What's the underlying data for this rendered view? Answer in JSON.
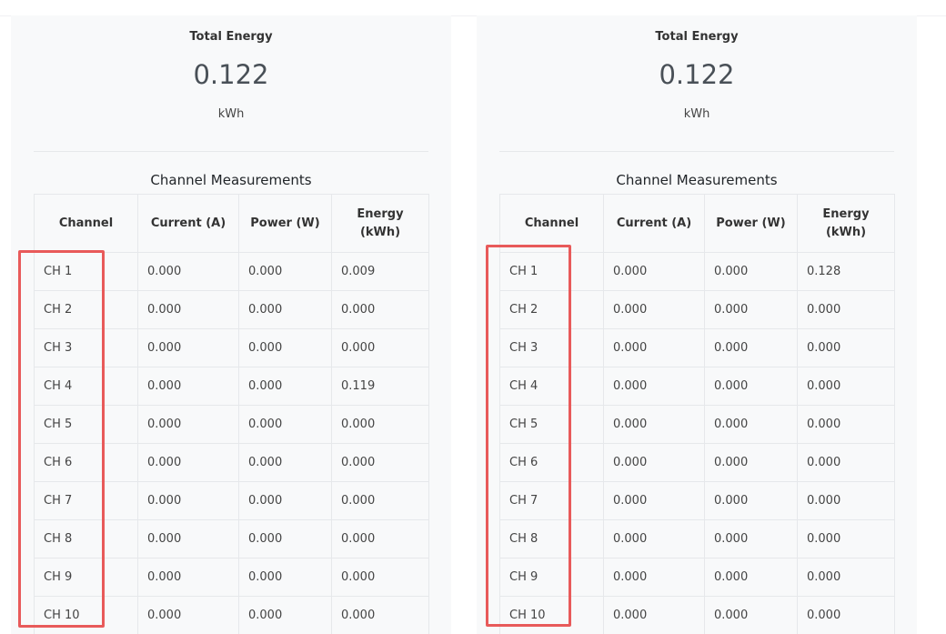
{
  "panels": [
    {
      "summary": {
        "title": "Total Energy",
        "value": "0.122",
        "unit": "kWh"
      },
      "table_title": "Channel Measurements",
      "headers": [
        "Channel",
        "Current (A)",
        "Power (W)",
        "Energy (kWh)"
      ],
      "rows": [
        [
          "CH 1",
          "0.000",
          "0.000",
          "0.009"
        ],
        [
          "CH 2",
          "0.000",
          "0.000",
          "0.000"
        ],
        [
          "CH 3",
          "0.000",
          "0.000",
          "0.000"
        ],
        [
          "CH 4",
          "0.000",
          "0.000",
          "0.119"
        ],
        [
          "CH 5",
          "0.000",
          "0.000",
          "0.000"
        ],
        [
          "CH 6",
          "0.000",
          "0.000",
          "0.000"
        ],
        [
          "CH 7",
          "0.000",
          "0.000",
          "0.000"
        ],
        [
          "CH 8",
          "0.000",
          "0.000",
          "0.000"
        ],
        [
          "CH 9",
          "0.000",
          "0.000",
          "0.000"
        ],
        [
          "CH 10",
          "0.000",
          "0.000",
          "0.000"
        ]
      ]
    },
    {
      "summary": {
        "title": "Total Energy",
        "value": "0.122",
        "unit": "kWh"
      },
      "table_title": "Channel Measurements",
      "headers": [
        "Channel",
        "Current (A)",
        "Power (W)",
        "Energy (kWh)"
      ],
      "rows": [
        [
          "CH 1",
          "0.000",
          "0.000",
          "0.128"
        ],
        [
          "CH 2",
          "0.000",
          "0.000",
          "0.000"
        ],
        [
          "CH 3",
          "0.000",
          "0.000",
          "0.000"
        ],
        [
          "CH 4",
          "0.000",
          "0.000",
          "0.000"
        ],
        [
          "CH 5",
          "0.000",
          "0.000",
          "0.000"
        ],
        [
          "CH 6",
          "0.000",
          "0.000",
          "0.000"
        ],
        [
          "CH 7",
          "0.000",
          "0.000",
          "0.000"
        ],
        [
          "CH 8",
          "0.000",
          "0.000",
          "0.000"
        ],
        [
          "CH 9",
          "0.000",
          "0.000",
          "0.000"
        ],
        [
          "CH 10",
          "0.000",
          "0.000",
          "0.000"
        ]
      ]
    }
  ],
  "colors": {
    "panel_bg": "#f8f9fa",
    "border": "#e6e8eb",
    "highlight": "#e85a5a"
  }
}
